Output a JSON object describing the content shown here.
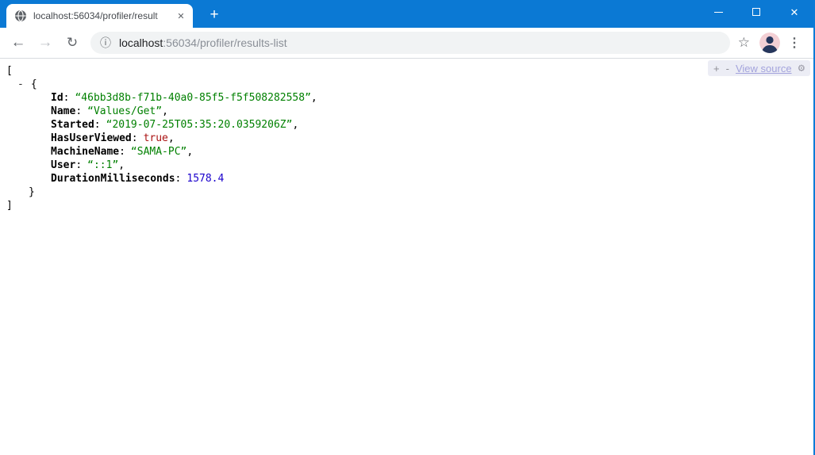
{
  "window": {
    "controls": {
      "minimize": "minimize",
      "maximize": "maximize",
      "close": "close"
    },
    "titlebar_color": "#0b79d4",
    "border_color": "#0b7bd7"
  },
  "tabstrip": {
    "tab_title": "localhost:56034/profiler/result",
    "new_tab_label": "+"
  },
  "toolbar": {
    "url_host": "localhost",
    "url_rest": ":56034/profiler/results-list"
  },
  "icons": {
    "back": "←",
    "forward": "→",
    "reload": "↻",
    "page_info": "ⓘ",
    "bookmark_star": "☆",
    "menu_dots": "⋮",
    "tab_close": "✕",
    "window_close": "✕",
    "settings_gear": "⚙"
  },
  "jsonview_toolbar": {
    "expand_label": "+",
    "collapse_label": "-",
    "view_source_label": "View source"
  },
  "json": {
    "open_bracket": "[",
    "collapser": "-",
    "open_brace": "{",
    "close_brace": "}",
    "close_bracket": "]",
    "entries": [
      {
        "key": "Id",
        "value": "“46bb3d8b-f71b-40a0-85f5-f5f508282558”",
        "type": "string",
        "suffix": ","
      },
      {
        "key": "Name",
        "value": "“Values/Get”",
        "type": "string",
        "suffix": ","
      },
      {
        "key": "Started",
        "value": "“2019-07-25T05:35:20.0359206Z”",
        "type": "string",
        "suffix": ","
      },
      {
        "key": "HasUserViewed",
        "value": "true",
        "type": "boolean",
        "suffix": ","
      },
      {
        "key": "MachineName",
        "value": "“SAMA-PC”",
        "type": "string",
        "suffix": ","
      },
      {
        "key": "User",
        "value": "“::1”",
        "type": "string",
        "suffix": ","
      },
      {
        "key": "DurationMilliseconds",
        "value": "1578.4",
        "type": "number",
        "suffix": ""
      }
    ]
  },
  "colors": {
    "string_value": "#008000",
    "boolean_value": "#aa1111",
    "number_value": "#1a01cc",
    "view_source_link": "#a3a3dc",
    "jv_toolbar_bg": "#ecedf5"
  }
}
